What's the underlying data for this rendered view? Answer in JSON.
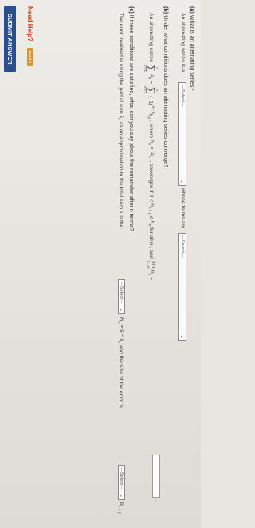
{
  "a": {
    "num": "(a)",
    "question": "What is an alternating series?",
    "sentence_start": "An alternating series is a",
    "select1": "---Select---",
    "sentence_mid": "whose terms are",
    "select2": "---Select---",
    "sentence_end": "."
  },
  "b": {
    "num": "(b)",
    "question": "Under what conditions does an alternating series converge?",
    "lead": "An alternating series",
    "sum_sym": "∑",
    "sum_top": "∞",
    "sum_bottom": "n = 1",
    "a_n": "a",
    "eq": "=",
    "series_term": "(−1)",
    "exp": "n − 1",
    "b_n": "b",
    "where": ", where",
    "bn_def": "= |a",
    "converges_if": "|, converges if 0 <",
    "bn1": "b",
    "le": "≤",
    "bn2": "b",
    "forall": "for all",
    "n_var": "n",
    "and_lim": ", and",
    "lim": "lim",
    "lim_sub": "n→∞",
    "lim_b": "b",
    "lim_eq": "=",
    "end": "."
  },
  "c": {
    "num": "(c)",
    "question": "If these conditions are satisfied, what can you say about the remainder after n terms?",
    "line_start": "The error involved in using the partial sum",
    "s_n": "s",
    "line_mid": "as an approximation to the total sum s is the",
    "select": "---Select---",
    "r_n": "R",
    "rn_def": "= s − s",
    "line_mid2": "and the size of the error is",
    "select2": "---Select---",
    "b_tail": "b",
    "end": "."
  },
  "help": {
    "label": "Need Help?",
    "read_it": "Read It"
  },
  "submit": {
    "label": "SUBMIT ANSWER"
  }
}
